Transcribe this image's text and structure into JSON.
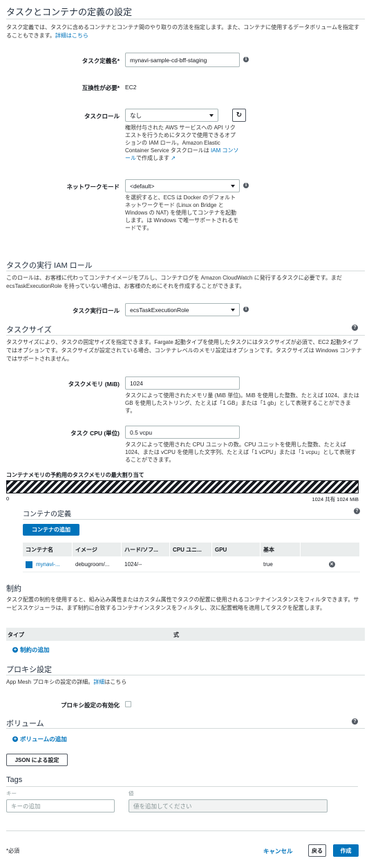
{
  "page": {
    "title": "タスクとコンテナの定義の設定",
    "intro": "タスク定義では、タスクに含めるコンテナとコンテナ間のやり取りの方法を指定します。また、コンテナに使用するデータボリュームを指定することもできます。",
    "intro_link": "詳細はこちら"
  },
  "task_definition": {
    "name_label": "タスク定義名*",
    "name_value": "mynavi-sample-cd-bff-staging",
    "compat_label": "互換性が必要*",
    "compat_value": "EC2",
    "role_label": "タスクロール",
    "role_value": "なし",
    "role_help_1": "権限付与された AWS サービスへの API リクエストを行うためにタスクで使用できるオプションの IAM ロール。Amazon Elastic Container Service タスクロールは",
    "role_help_link": "IAM コンソール",
    "role_help_2": "で作成します",
    "network_label": "ネットワークモード",
    "network_value": "<default>",
    "network_help": "を選択すると、ECS は Docker のデフォルトネットワークモード (Linux on Bridge と Windows の NAT) を使用してコンテナを起動します。は Windows で唯一サポートされるモードです。"
  },
  "exec_role": {
    "title": "タスクの実行 IAM ロール",
    "desc": "このロールは、お客様に代わってコンテナイメージをプルし、コンテナログを Amazon CloudWatch に発行するタスクに必要です。まだ ecsTaskExecutionRole を持っていない場合は、お客様のためにそれを作成することができます。",
    "label": "タスク実行ロール",
    "value": "ecsTaskExecutionRole"
  },
  "task_size": {
    "title": "タスクサイズ",
    "desc": "タスクサイズにより、タスクの固定サイズを指定できます。Fargate 起動タイプを使用したタスクにはタスクサイズが必須で、EC2 起動タイプではオプションです。タスクサイズが設定されている場合、コンテナレベルのメモリ設定はオプションです。タスクサイズは Windows コンテナではサポートされません。",
    "memory_label": "タスクメモリ (MiB)",
    "memory_value": "1024",
    "memory_help": "タスクによって使用されたメモリ量 (MiB 単位)。MiB を使用した整数、たとえば 1024、または GB を使用したストリング、たとえば「1 GB」または「1 gb」として表現することができます。",
    "cpu_label": "タスク CPU (単位)",
    "cpu_value": "0.5 vcpu",
    "cpu_help": "タスクによって使用された CPU ユニットの数。CPU ユニットを使用した整数、たとえば 1024、または vCPU を使用した文字列、たとえば「1 vCPU」または「1 vcpu」として表現することができます。"
  },
  "memory_bar": {
    "title": "コンテナメモリの予約用のタスクメモリの最大割り当て",
    "min_label": "0",
    "max_label": "1024 共有 1024 MiB",
    "fill_fraction": 1.0
  },
  "containers": {
    "title": "コンテナの定義",
    "add_button": "コンテナの追加",
    "columns": [
      "コンテナ名",
      "イメージ",
      "ハード/ソフ...",
      "CPU ユニ...",
      "GPU",
      "基本"
    ],
    "rows": [
      {
        "name": "mynavi-...",
        "image": "debugroom/...",
        "memory": "1024/--",
        "cpu": "",
        "gpu": "",
        "essential": "true"
      }
    ]
  },
  "constraints": {
    "title": "制約",
    "desc": "タスク配置の制約を使用すると、組み込み属性またはカスタム属性でタスクの配置に使用されるコンテナインスタンスをフィルタできます。サービススケジューラは、まず制約に合致するコンテナインスタンスをフィルタし、次に配置戦略を適用してタスクを配置します。",
    "col_type": "タイプ",
    "col_expr": "式",
    "add_link": "制約の追加"
  },
  "proxy": {
    "title": "プロキシ設定",
    "desc": "App Mesh プロキシの設定の詳細。",
    "desc_link": "詳細",
    "desc_tail": "はこちら",
    "enable_label": "プロキシ設定の有効化"
  },
  "volumes": {
    "title": "ボリューム",
    "add_link": "ボリュームの追加"
  },
  "json_button": "JSON による設定",
  "tags": {
    "title": "Tags",
    "key_header": "キー",
    "value_header": "値",
    "key_placeholder": "キーの追加",
    "value_placeholder": "値を追加してください"
  },
  "footer": {
    "required_note": "*必須",
    "cancel": "キャンセル",
    "back": "戻る",
    "create": "作成"
  },
  "colors": {
    "accent": "#0073bb",
    "text": "#16191f",
    "rule": "#d5dbdb"
  }
}
